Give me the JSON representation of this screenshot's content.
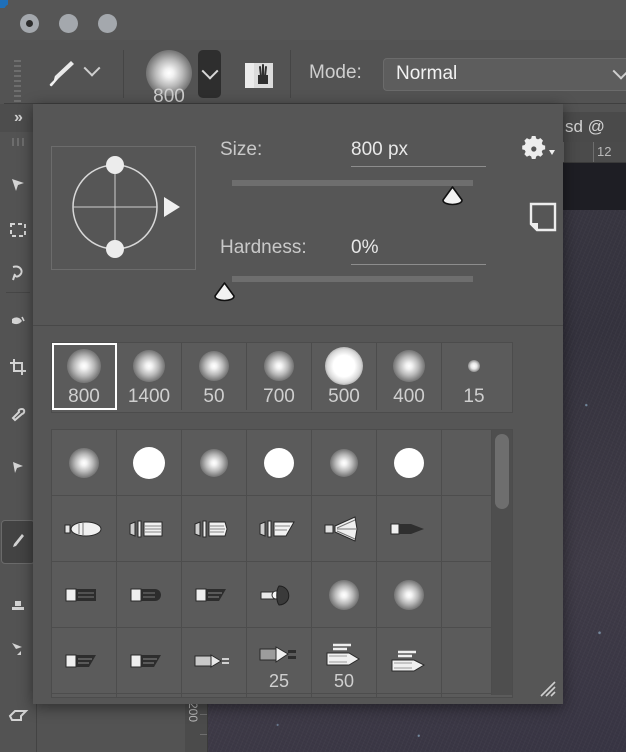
{
  "window": {
    "traffic_lights": [
      "close",
      "minimize",
      "maximize"
    ],
    "document_title": "sd @"
  },
  "options_bar": {
    "tool_icon": "paintbrush-icon",
    "tool_preset_chevron": "chevron-down-icon",
    "brush_preview_size": "800",
    "brush_picker_chevron": "chevron-down-icon",
    "brush_settings_icon": "brush-settings-panel-icon",
    "mode_label": "Mode:",
    "mode_value": "Normal",
    "mode_chevron": "chevron-down-icon"
  },
  "left_toolbar": {
    "collapse_label": "»",
    "tools": [
      {
        "name": "move-tool",
        "icon": "move-icon"
      },
      {
        "name": "marquee-tool",
        "icon": "rect-marquee-icon"
      },
      {
        "name": "lasso-tool",
        "icon": "lasso-icon"
      },
      {
        "name": "quick-selection-tool",
        "icon": "quick-select-icon"
      },
      {
        "name": "crop-tool",
        "icon": "crop-icon"
      },
      {
        "name": "eyedropper-tool",
        "icon": "eyedropper-icon"
      },
      {
        "name": "healing-brush-tool",
        "icon": "healing-brush-icon"
      },
      {
        "name": "brush-tool",
        "icon": "paintbrush-icon",
        "active": true
      },
      {
        "name": "clone-stamp-tool",
        "icon": "clone-stamp-icon"
      },
      {
        "name": "history-brush-tool",
        "icon": "history-brush-icon"
      },
      {
        "name": "eraser-tool",
        "icon": "eraser-icon"
      }
    ]
  },
  "brush_picker": {
    "size": {
      "label": "Size:",
      "value": "800 px",
      "slider_percent": 88
    },
    "hardness": {
      "label": "Hardness:",
      "value": "0%",
      "slider_percent": 0
    },
    "angle_control": {
      "name": "brush-angle-roundness-control"
    },
    "gear_icon": "gear-icon",
    "new_preset_icon": "new-preset-icon",
    "recent_presets": [
      {
        "label": "800",
        "kind": "soft-round",
        "d": 34,
        "hard": 0.1,
        "selected": true
      },
      {
        "label": "1400",
        "kind": "soft-round",
        "d": 32,
        "hard": 0.1,
        "selected": false
      },
      {
        "label": "50",
        "kind": "soft-round",
        "d": 30,
        "hard": 0.1,
        "selected": false
      },
      {
        "label": "700",
        "kind": "soft-round",
        "d": 30,
        "hard": 0.14,
        "selected": false
      },
      {
        "label": "500",
        "kind": "soft-round",
        "d": 38,
        "hard": 0.46,
        "selected": false
      },
      {
        "label": "400",
        "kind": "soft-round",
        "d": 32,
        "hard": 0.14,
        "selected": false
      },
      {
        "label": "15",
        "kind": "soft-round",
        "d": 11,
        "hard": 0.34,
        "selected": false
      }
    ],
    "brush_grid": [
      [
        {
          "label": "",
          "kind": "soft-round",
          "d": 30,
          "hard": 0.12
        },
        {
          "label": "",
          "kind": "hard-round",
          "d": 32
        },
        {
          "label": "",
          "kind": "soft-round",
          "d": 28,
          "hard": 0.1
        },
        {
          "label": "",
          "kind": "hard-round",
          "d": 30
        },
        {
          "label": "",
          "kind": "soft-round",
          "d": 28,
          "hard": 0.12
        },
        {
          "label": "",
          "kind": "hard-round",
          "d": 30
        }
      ],
      [
        {
          "label": "",
          "kind": "bristle-pointed"
        },
        {
          "label": "",
          "kind": "bristle-flat"
        },
        {
          "label": "",
          "kind": "bristle-flat2"
        },
        {
          "label": "",
          "kind": "bristle-angled"
        },
        {
          "label": "",
          "kind": "bristle-fan"
        },
        {
          "label": "",
          "kind": "bristle-round-point"
        }
      ],
      [
        {
          "label": "",
          "kind": "erodible-block"
        },
        {
          "label": "",
          "kind": "erodible-round"
        },
        {
          "label": "",
          "kind": "erodible-flat"
        },
        {
          "label": "",
          "kind": "airbrush-cone"
        },
        {
          "label": "",
          "kind": "soft-round",
          "d": 30,
          "hard": 0.18
        },
        {
          "label": "",
          "kind": "soft-round",
          "d": 30,
          "hard": 0.18
        }
      ],
      [
        {
          "label": "",
          "kind": "erodible-flat"
        },
        {
          "label": "",
          "kind": "erodible-flat"
        },
        {
          "label": "",
          "kind": "airbrush-tip"
        },
        {
          "label": "25",
          "kind": "airbrush-tip2"
        },
        {
          "label": "50",
          "kind": "airbrush-pen"
        },
        {
          "label": "",
          "kind": "airbrush-pen"
        }
      ]
    ],
    "scrollbar": {
      "name": "brush-grid-scrollbar",
      "thumb_position": "top"
    },
    "resize_grip": "resize-grip-icon"
  },
  "rulers": {
    "horizontal_marks": [
      "12"
    ],
    "vertical_marks": [
      "200"
    ]
  },
  "colors": {
    "panel_bg": "#565656",
    "chrome_bg": "#535353",
    "cell_bg": "#5b5b5b",
    "text": "#cfcfcf",
    "text_bright": "#f2f2f2",
    "accent": "#1f6fb8",
    "canvas_dark": "#1e1e24"
  }
}
